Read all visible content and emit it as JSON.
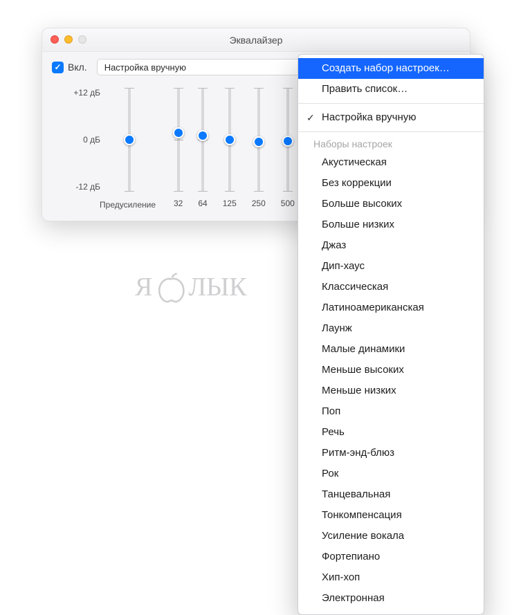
{
  "window": {
    "title": "Эквалайзер"
  },
  "toolbar": {
    "enable_label": "Вкл.",
    "preset_selected": "Настройка вручную"
  },
  "eq": {
    "db_plus": "+12 дБ",
    "db_zero": "0 дБ",
    "db_minus": "-12 дБ",
    "preamp_label": "Предусиление",
    "preamp_value_percent": 50,
    "bands": [
      {
        "hz": "32",
        "value_percent": 43
      },
      {
        "hz": "64",
        "value_percent": 46
      },
      {
        "hz": "125",
        "value_percent": 50
      },
      {
        "hz": "250",
        "value_percent": 52
      },
      {
        "hz": "500",
        "value_percent": 51
      }
    ]
  },
  "menu": {
    "highlighted": "Создать набор настроек…",
    "edit": "Править список…",
    "manual": "Настройка вручную",
    "section_header": "Наборы настроек",
    "presets": [
      "Акустическая",
      "Без коррекции",
      "Больше высоких",
      "Больше низких",
      "Джаз",
      "Дип-хаус",
      "Классическая",
      "Латиноамериканская",
      "Лаунж",
      "Малые динамики",
      "Меньше высоких",
      "Меньше низких",
      "Поп",
      "Речь",
      "Ритм-энд-блюз",
      "Рок",
      "Танцевальная",
      "Тонкомпенсация",
      "Усиление вокала",
      "Фортепиано",
      "Хип-хоп",
      "Электронная"
    ]
  },
  "watermark": {
    "left": "Я",
    "right": "ЛЫК"
  }
}
